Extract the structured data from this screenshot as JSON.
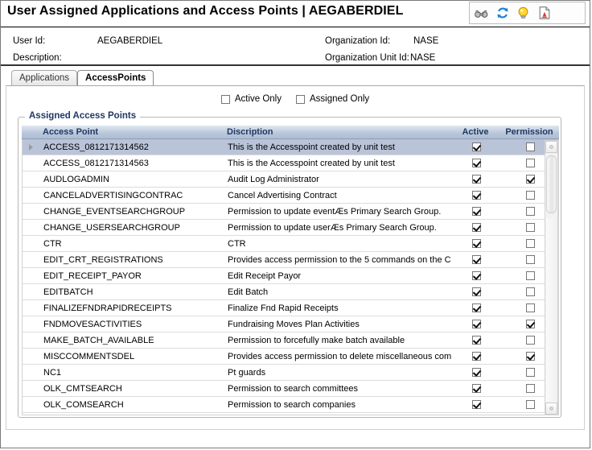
{
  "header": {
    "title": "User Assigned Applications and Access Points  |  AEGABERDIEL",
    "toolbar": [
      {
        "name": "binoculars-icon",
        "label": "Search"
      },
      {
        "name": "refresh-icon",
        "label": "Refresh"
      },
      {
        "name": "lightbulb-icon",
        "label": "Hints"
      },
      {
        "name": "report-icon",
        "label": "Report"
      }
    ]
  },
  "info": {
    "user_id_label": "User Id:",
    "user_id_value": "AEGABERDIEL",
    "description_label": "Description:",
    "description_value": "",
    "organization_id_label": "Organization Id:",
    "organization_id_value": "NASE",
    "organization_unit_label": "Organization Unit Id:",
    "organization_unit_value": "NASE"
  },
  "tabs": [
    {
      "label": "Applications",
      "active": false
    },
    {
      "label": "AccessPoints",
      "active": true
    }
  ],
  "filters": [
    {
      "label": "Active Only",
      "checked": false
    },
    {
      "label": "Assigned Only",
      "checked": false
    }
  ],
  "group": {
    "legend": "Assigned Access Points"
  },
  "grid": {
    "columns": [
      "Access Point",
      "Discription",
      "Active",
      "Permission"
    ],
    "rows": [
      {
        "access_point": "ACCESS_0812171314562",
        "description": "This is the Accesspoint created by unit test",
        "active": true,
        "permission": false,
        "selected": true
      },
      {
        "access_point": "ACCESS_0812171314563",
        "description": "This is the Accesspoint created by unit test",
        "active": true,
        "permission": false,
        "selected": false
      },
      {
        "access_point": "AUDLOGADMIN",
        "description": "Audit Log Administrator",
        "active": true,
        "permission": true,
        "selected": false
      },
      {
        "access_point": "CANCELADVERTISINGCONTRAC",
        "description": "Cancel Advertising Contract",
        "active": true,
        "permission": false,
        "selected": false
      },
      {
        "access_point": "CHANGE_EVENTSEARCHGROUP",
        "description": "Permission to update eventÆs Primary Search Group.",
        "active": true,
        "permission": false,
        "selected": false
      },
      {
        "access_point": "CHANGE_USERSEARCHGROUP",
        "description": "Permission to update userÆs Primary Search Group.",
        "active": true,
        "permission": false,
        "selected": false
      },
      {
        "access_point": "CTR",
        "description": "CTR",
        "active": true,
        "permission": false,
        "selected": false
      },
      {
        "access_point": "EDIT_CRT_REGISTRATIONS",
        "description": "Provides access permission to the 5 commands on the C",
        "active": true,
        "permission": false,
        "selected": false
      },
      {
        "access_point": "EDIT_RECEIPT_PAYOR",
        "description": "Edit Receipt Payor",
        "active": true,
        "permission": false,
        "selected": false
      },
      {
        "access_point": "EDITBATCH",
        "description": "Edit Batch",
        "active": true,
        "permission": false,
        "selected": false
      },
      {
        "access_point": "FINALIZEFNDRAPIDRECEIPTS",
        "description": "Finalize Fnd Rapid Receipts",
        "active": true,
        "permission": false,
        "selected": false
      },
      {
        "access_point": "FNDMOVESACTIVITIES",
        "description": "Fundraising Moves Plan Activities",
        "active": true,
        "permission": true,
        "selected": false
      },
      {
        "access_point": "MAKE_BATCH_AVAILABLE",
        "description": "Permission to forcefully make batch available",
        "active": true,
        "permission": false,
        "selected": false
      },
      {
        "access_point": "MISCCOMMENTSDEL",
        "description": "Provides access permission to delete miscellaneous com",
        "active": true,
        "permission": true,
        "selected": false
      },
      {
        "access_point": "NC1",
        "description": "Pt guards",
        "active": true,
        "permission": false,
        "selected": false
      },
      {
        "access_point": "OLK_CMTSEARCH",
        "description": "Permission to search committees",
        "active": true,
        "permission": false,
        "selected": false
      },
      {
        "access_point": "OLK_COMSEARCH",
        "description": "Permission to search companies",
        "active": true,
        "permission": false,
        "selected": false
      }
    ]
  },
  "colors": {
    "header_text": "#1f3864",
    "grid_header_bg": "#b9c6da",
    "selected_row_bg": "#b9c4d9",
    "window_border": "#7a7a7a"
  }
}
